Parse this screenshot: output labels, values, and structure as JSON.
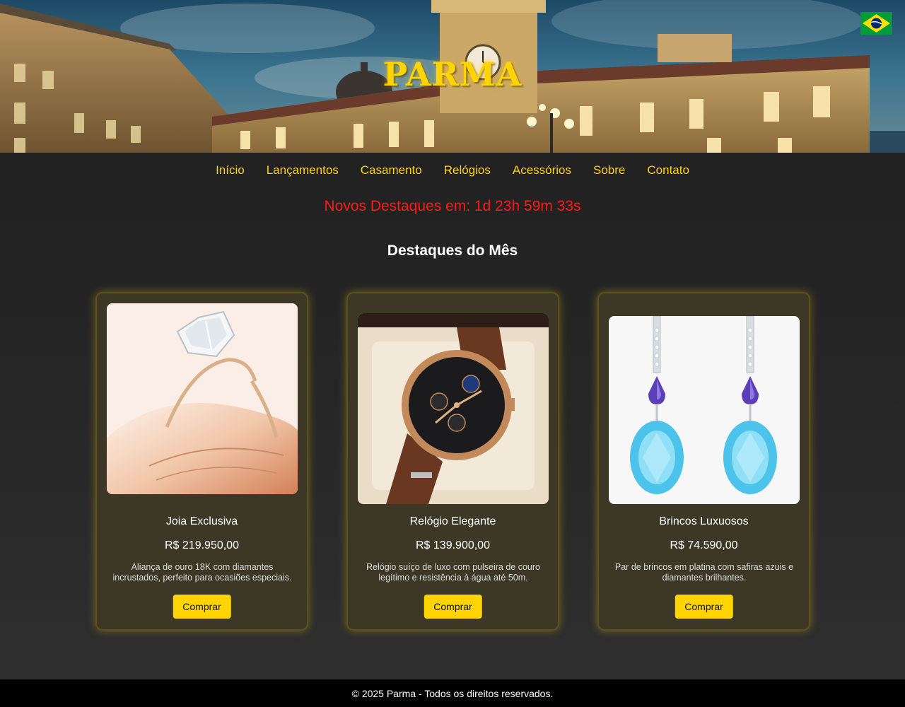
{
  "header": {
    "brand": "PARMA",
    "language_flag": "brazil-flag-icon"
  },
  "nav": {
    "items": [
      "Início",
      "Lançamentos",
      "Casamento",
      "Relógios",
      "Acessórios",
      "Sobre",
      "Contato"
    ]
  },
  "countdown": {
    "text": "Novos Destaques em: 1d 23h 59m 33s"
  },
  "highlights": {
    "title": "Destaques do Mês",
    "products": [
      {
        "name": "Joia Exclusiva",
        "price": "R$ 219.950,00",
        "description": "Aliança de ouro 18K com diamantes incrustados, perfeito para ocasiões especiais.",
        "button": "Comprar"
      },
      {
        "name": "Relógio Elegante",
        "price": "R$ 139.900,00",
        "description": "Relógio suíço de luxo com pulseira de couro legítimo e resistência à água até 50m.",
        "button": "Comprar"
      },
      {
        "name": "Brincos Luxuosos",
        "price": "R$ 74.590,00",
        "description": "Par de brincos em platina com safiras azuis e diamantes brilhantes.",
        "button": "Comprar"
      }
    ]
  },
  "footer": {
    "text": "© 2025 Parma - Todos os direitos reservados."
  },
  "colors": {
    "accent": "#ffd400",
    "countdown": "#ff1a1a",
    "card_bg": "#3d3825",
    "footer_bg": "#000000"
  }
}
